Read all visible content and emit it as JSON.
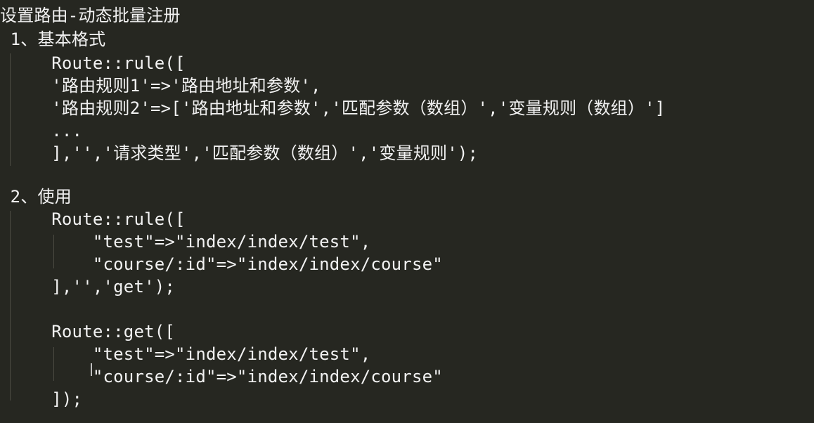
{
  "document": {
    "lines": [
      "设置路由-动态批量注册",
      " 1、基本格式",
      "     Route::rule([",
      "     '路由规则1'=>'路由地址和参数',",
      "     '路由规则2'=>['路由地址和参数','匹配参数（数组）','变量规则（数组）']",
      "     ...",
      "     ],'','请求类型','匹配参数（数组）','变量规则');",
      "",
      " 2、使用",
      "     Route::rule([",
      "         \"test\"=>\"index/index/test\",",
      "         \"course/:id\"=>\"index/index/course\"",
      "     ],'','get');",
      "",
      "     Route::get([",
      "         \"test\"=>\"index/index/test\",",
      "         \"course/:id\"=>\"index/index/course\"",
      "     ]);"
    ]
  }
}
